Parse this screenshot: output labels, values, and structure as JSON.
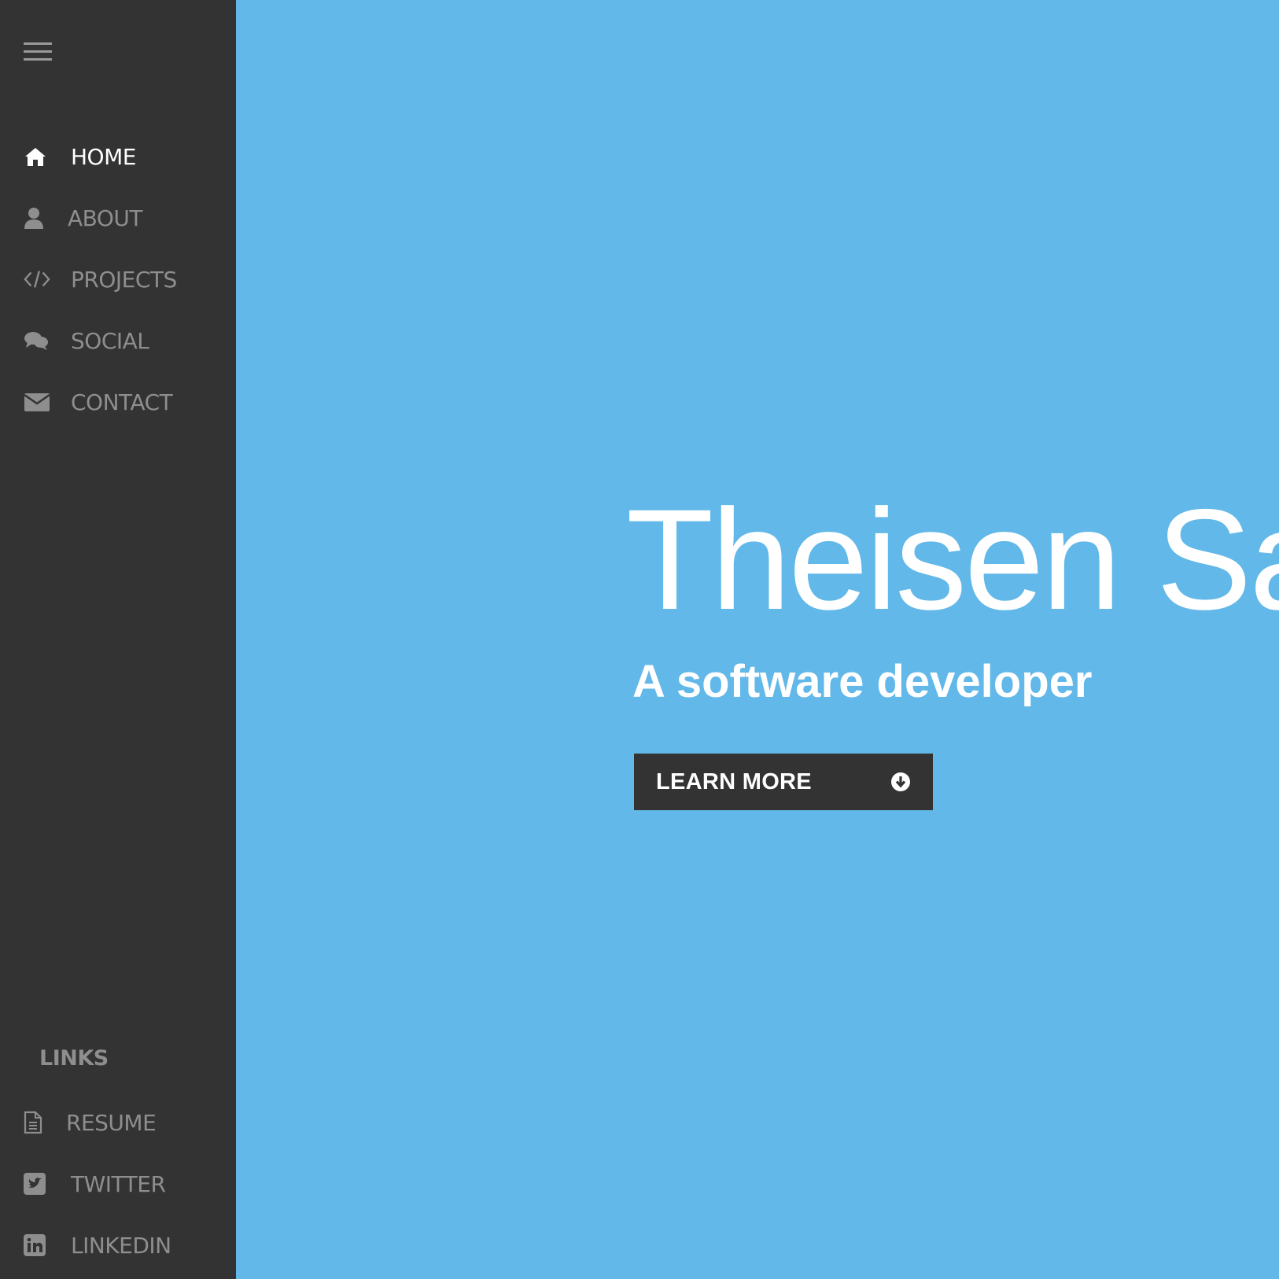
{
  "colors": {
    "hero_background": "#62b8e8",
    "sidebar_background": "#333333",
    "nav_text": "#8e8e8e",
    "nav_active_text": "#ffffff",
    "button_background": "#333333"
  },
  "sidebar": {
    "menu_icon": "hamburger-menu-icon",
    "nav": [
      {
        "label": "HOME",
        "icon": "home-icon",
        "active": true
      },
      {
        "label": "ABOUT",
        "icon": "user-icon",
        "active": false
      },
      {
        "label": "PROJECTS",
        "icon": "code-icon",
        "active": false
      },
      {
        "label": "SOCIAL",
        "icon": "comments-icon",
        "active": false
      },
      {
        "label": "CONTACT",
        "icon": "envelope-icon",
        "active": false
      }
    ],
    "links_heading": "LINKS",
    "links": [
      {
        "label": "RESUME",
        "icon": "document-icon"
      },
      {
        "label": "TWITTER",
        "icon": "twitter-icon"
      },
      {
        "label": "LINKEDIN",
        "icon": "linkedin-icon"
      }
    ]
  },
  "hero": {
    "title": "Theisen Sa",
    "subtitle": "A software developer",
    "button_label": "LEARN MORE",
    "button_icon": "arrow-circle-down-icon"
  }
}
